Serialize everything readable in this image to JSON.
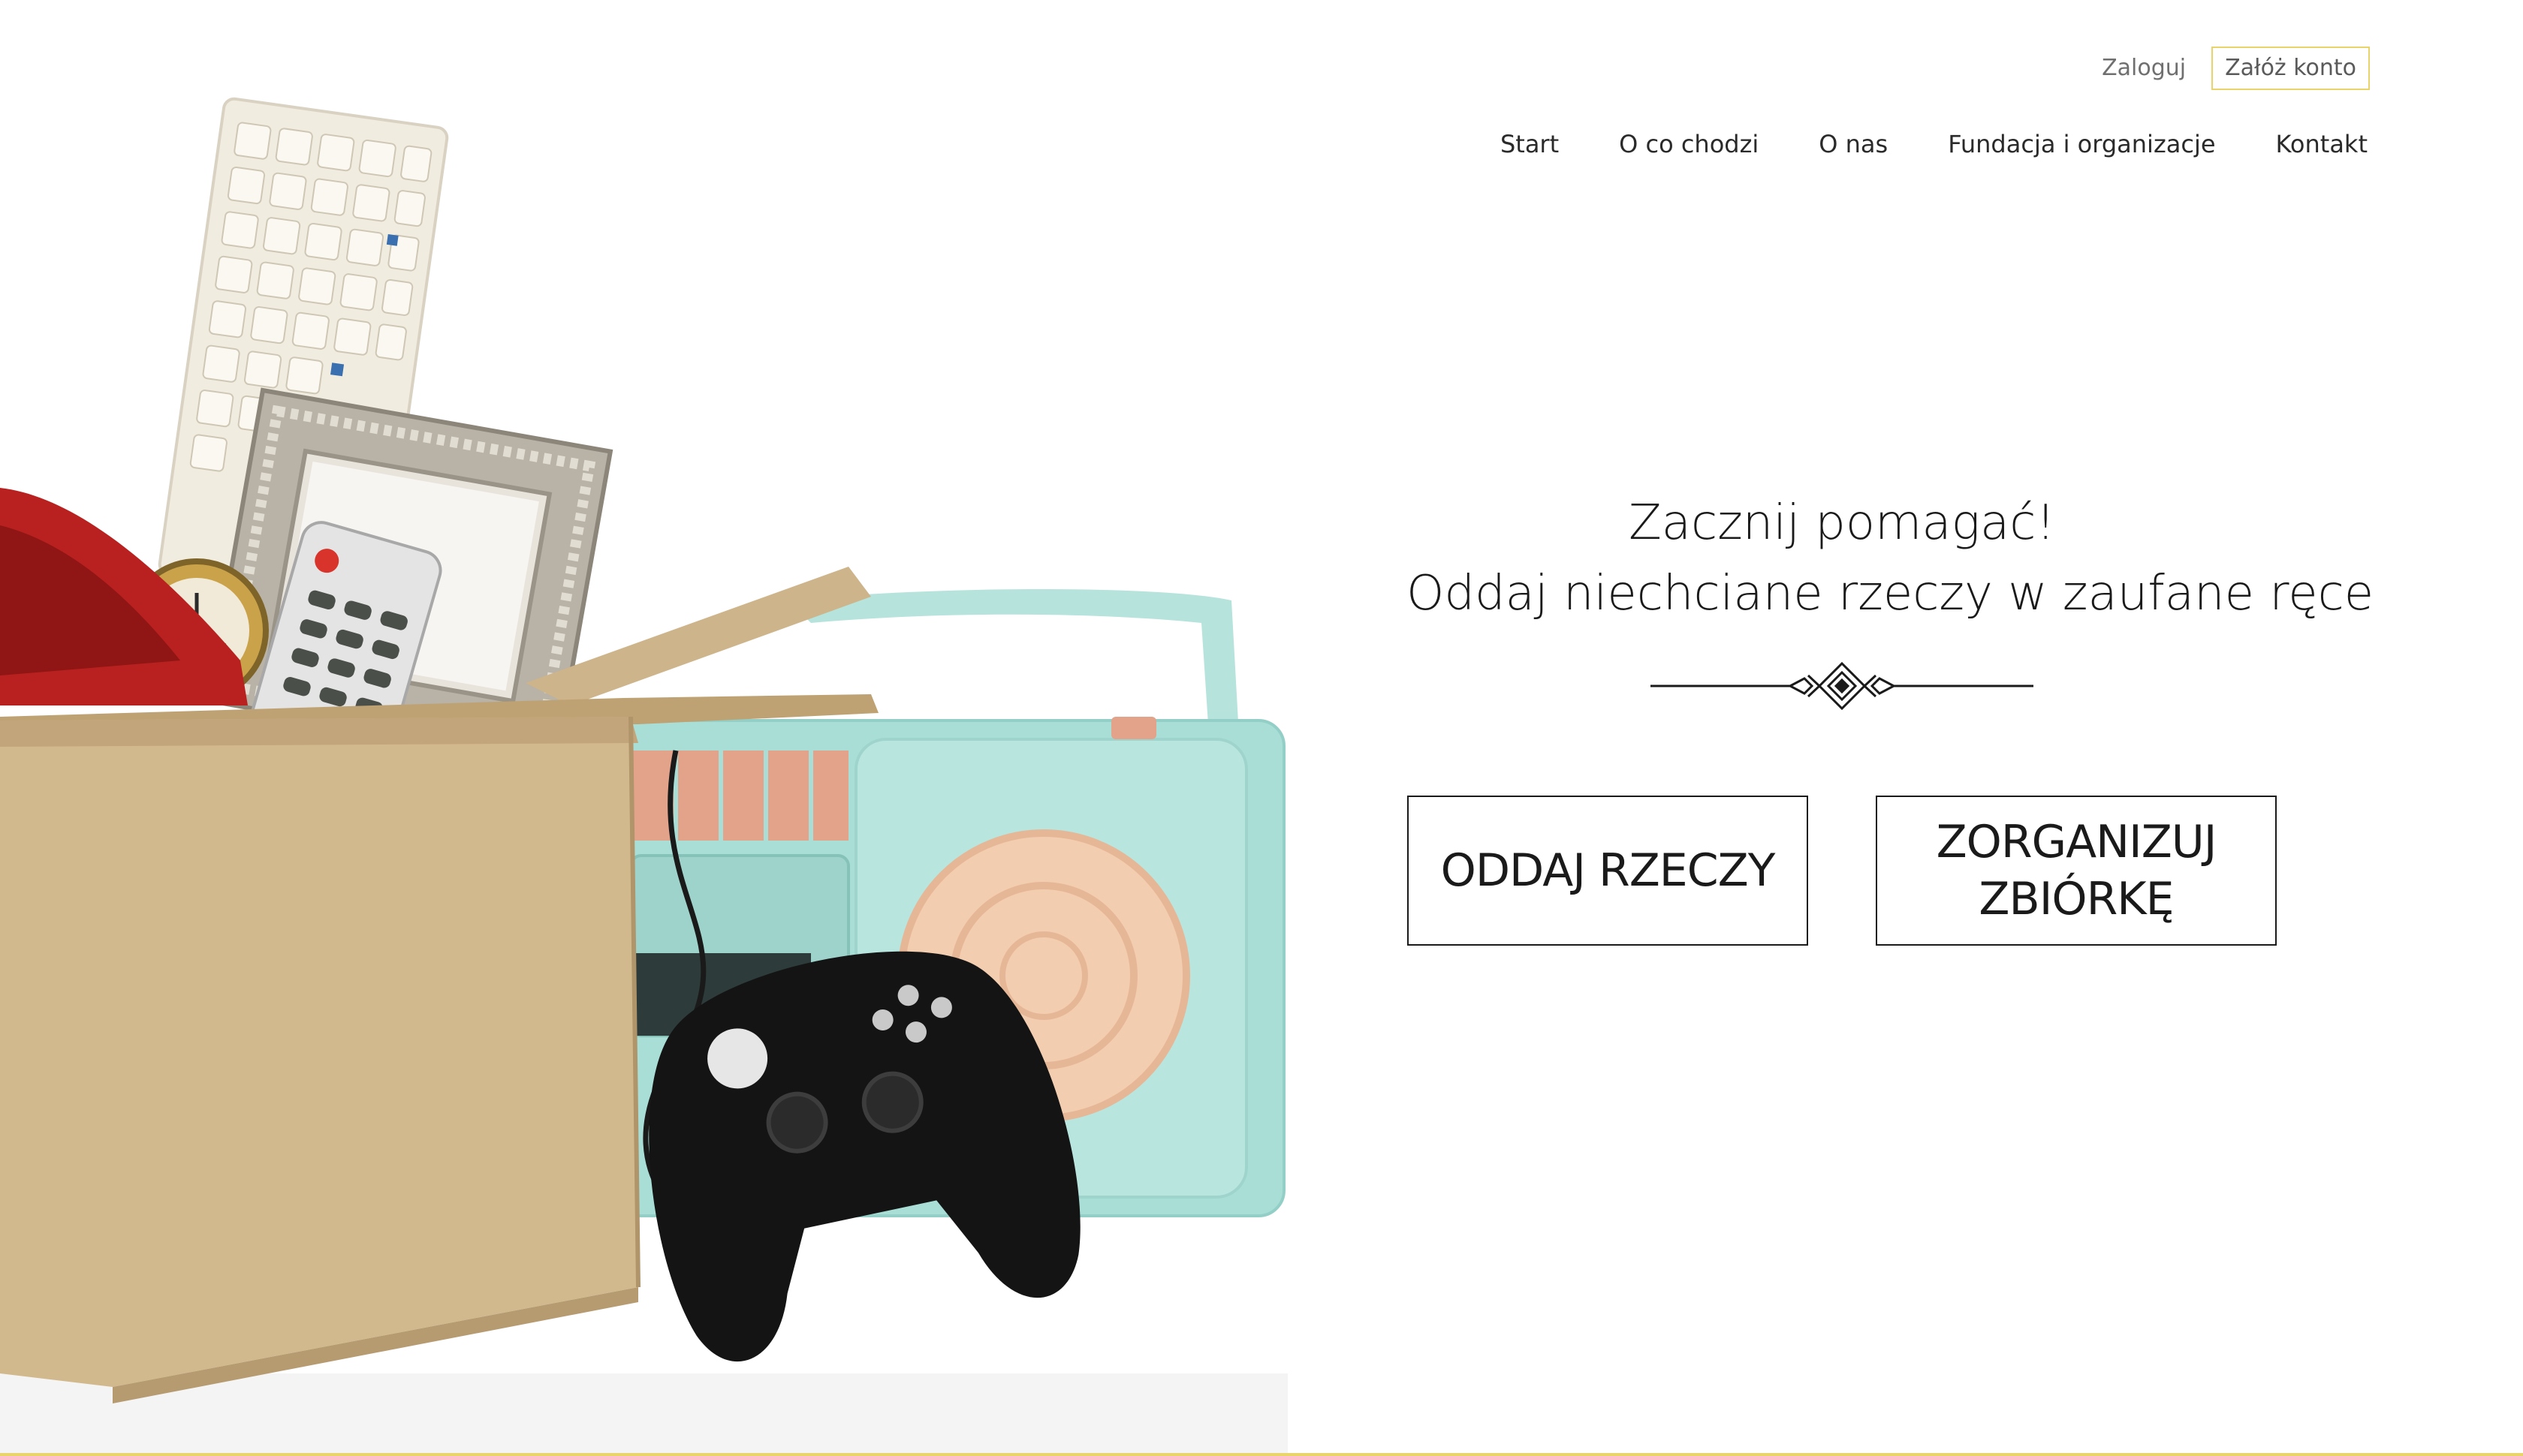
{
  "header": {
    "login_label": "Zaloguj",
    "register_label": "Załóż konto",
    "nav": [
      {
        "label": "Start"
      },
      {
        "label": "O co chodzi"
      },
      {
        "label": "O nas"
      },
      {
        "label": "Fundacja i organizacje"
      },
      {
        "label": "Kontakt"
      }
    ]
  },
  "hero": {
    "title_line1": "Zacznij pomagać!",
    "title_line2": "Oddaj niechciane rzeczy w zaufane ręce",
    "give_button_label": "ODDAJ RZECZY",
    "organize_button_label": "ZORGANIZUJ ZBIÓRKĘ"
  },
  "colors": {
    "accent": "#e8d46a",
    "text": "#1a1a1a",
    "muted": "#6f6f6f"
  }
}
